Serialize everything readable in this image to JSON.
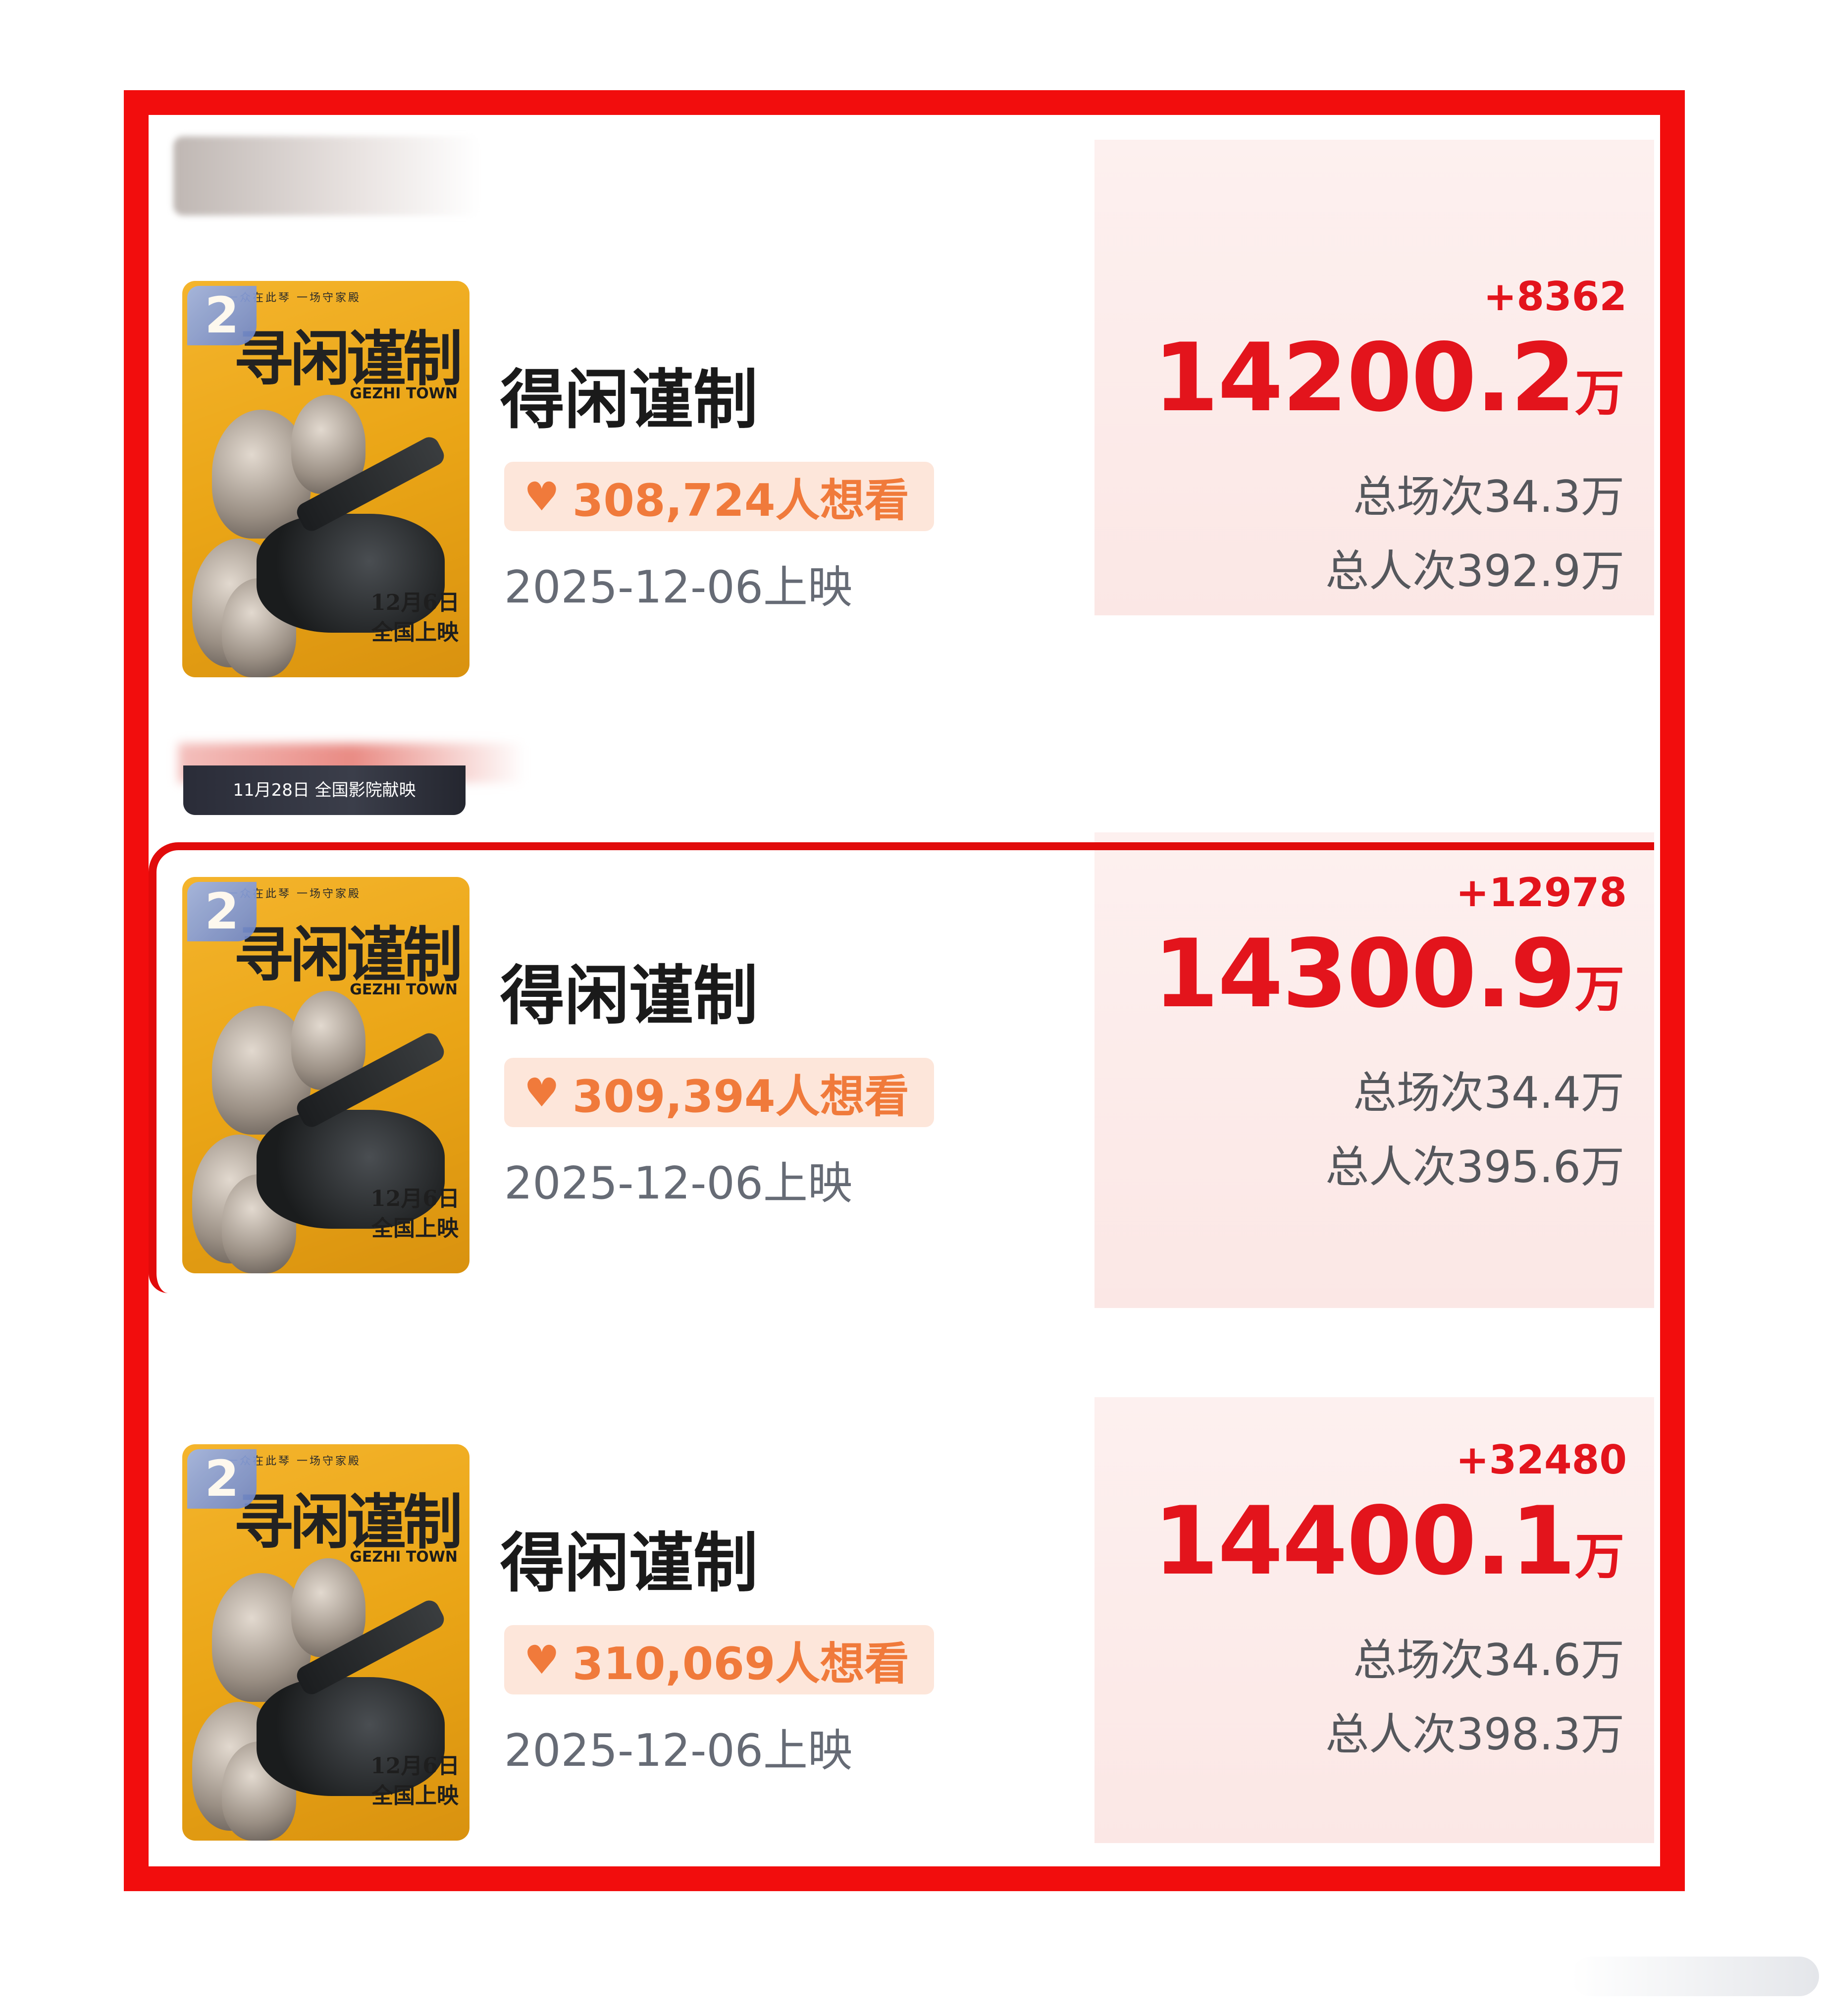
{
  "cards": [
    {
      "rank": "2",
      "poster_title": "寻闲谨制",
      "poster_subtitle": "GEZHI TOWN",
      "poster_tagline": "一众在此琴 一场守家殿",
      "poster_date": "12月6日",
      "poster_date2": "全国上映",
      "title": "得闲谨制",
      "want": "308,724人想看",
      "release": "2025-12-06上映",
      "delta": "+8362",
      "box_office": "14200.2",
      "box_unit": "万",
      "screenings": "总场次34.3万",
      "attendance": "总人次392.9万"
    },
    {
      "rank": "2",
      "poster_title": "寻闲谨制",
      "poster_subtitle": "GEZHI TOWN",
      "poster_tagline": "一众在此琴 一场守家殿",
      "poster_date": "12月6日",
      "poster_date2": "全国上映",
      "title": "得闲谨制",
      "want": "309,394人想看",
      "release": "2025-12-06上映",
      "delta": "+12978",
      "box_office": "14300.9",
      "box_unit": "万",
      "screenings": "总场次34.4万",
      "attendance": "总人次395.6万"
    },
    {
      "rank": "2",
      "poster_title": "寻闲谨制",
      "poster_subtitle": "GEZHI TOWN",
      "poster_tagline": "一众在此琴 一场守家殿",
      "poster_date": "12月6日",
      "poster_date2": "全国上映",
      "title": "得闲谨制",
      "want": "310,069人想看",
      "release": "2025-12-06上映",
      "delta": "+32480",
      "box_office": "14400.1",
      "box_unit": "万",
      "screenings": "总场次34.6万",
      "attendance": "总人次398.3万"
    }
  ],
  "peek_poster_text": "11月28日 全国影院献映",
  "colors": {
    "frame": "#f20d0d",
    "accent_red": "#e3141c",
    "want_bg": "#fde6da",
    "want_text": "#f07a3b"
  }
}
